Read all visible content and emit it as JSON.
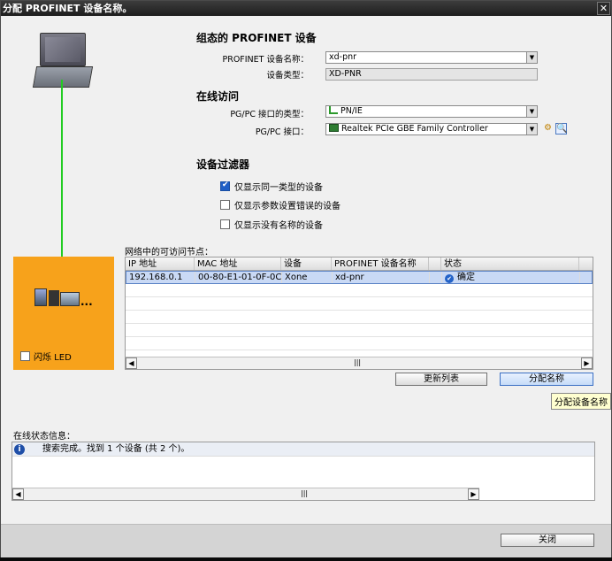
{
  "window": {
    "title": "分配 PROFINET 设备名称。",
    "close_glyph": "✕"
  },
  "configured": {
    "heading": "组态的 PROFINET 设备",
    "name_label": "PROFINET 设备名称：",
    "name_value": "xd-pnr",
    "type_label": "设备类型：",
    "type_value": "XD-PNR"
  },
  "online": {
    "heading": "在线访问",
    "iface_type_label": "PG/PC 接口的类型：",
    "iface_type_value": "PN/IE",
    "iface_label": "PG/PC 接口：",
    "iface_value": "Realtek PCIe GBE Family Controller"
  },
  "filter": {
    "heading": "设备过滤器",
    "options": [
      {
        "label": "仅显示同一类型的设备",
        "checked": true
      },
      {
        "label": "仅显示参数设置错误的设备",
        "checked": false
      },
      {
        "label": "仅显示没有名称的设备",
        "checked": false
      }
    ]
  },
  "device_panel": {
    "flash_label": "闪烁 LED",
    "dots": "..."
  },
  "nodes": {
    "label": "网络中的可访问节点：",
    "columns": [
      "IP 地址",
      "MAC 地址",
      "设备",
      "PROFINET 设备名称",
      "状态"
    ],
    "rows": [
      {
        "ip": "192.168.0.1",
        "mac": "00-80-E1-01-0F-0C",
        "device": "Xone",
        "name": "xd-pnr",
        "status": "确定"
      }
    ],
    "scroll_thumb": "|||"
  },
  "buttons": {
    "update_list": "更新列表",
    "assign_name": "分配名称",
    "close": "关闭"
  },
  "tooltip": "分配设备名称",
  "status": {
    "label": "在线状态信息：",
    "message": "搜索完成。找到 1 个设备 (共 2 个)。",
    "scroll_thumb": "|||"
  }
}
